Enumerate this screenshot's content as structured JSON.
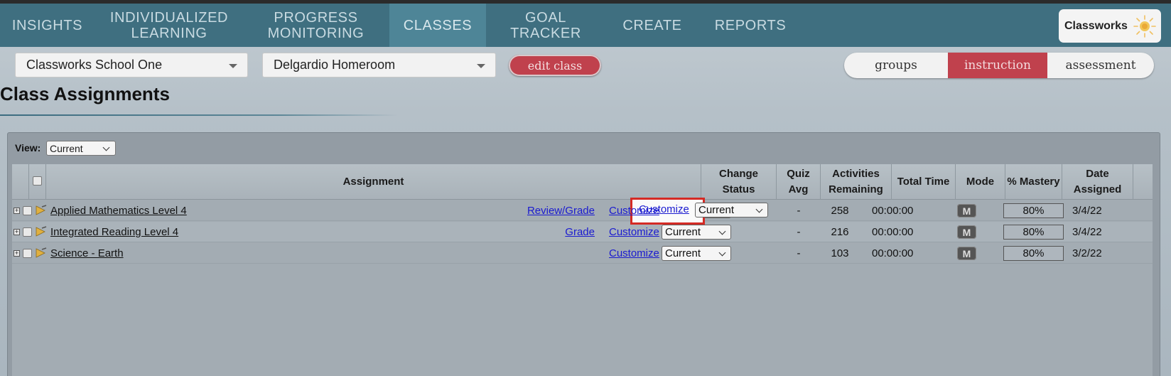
{
  "nav": {
    "items": [
      {
        "label": "INSIGHTS"
      },
      {
        "label": "INDIVIDUALIZED LEARNING"
      },
      {
        "label": "PROGRESS MONITORING"
      },
      {
        "label": "CLASSES"
      },
      {
        "label": "GOAL TRACKER"
      },
      {
        "label": "CREATE"
      },
      {
        "label": "REPORTS"
      }
    ],
    "active": "CLASSES",
    "brand": "Classworks"
  },
  "selectors": {
    "school": "Classworks School One",
    "class": "Delgardio Homeroom",
    "edit_class": "edit class"
  },
  "segments": {
    "groups": "groups",
    "instruction": "instruction",
    "assessment": "assessment",
    "selected": "instruction"
  },
  "page_title": "Class Assignments",
  "view": {
    "label": "View:",
    "value": "Current"
  },
  "table": {
    "headers": {
      "assignment": "Assignment",
      "change_status_1": "Change",
      "change_status_2": "Status",
      "quiz_avg_1": "Quiz",
      "quiz_avg_2": "Avg",
      "activities_1": "Activities",
      "activities_2": "Remaining",
      "total_time": "Total Time",
      "mode": "Mode",
      "mastery": "% Mastery",
      "date_1": "Date",
      "date_2": "Assigned"
    },
    "rows": [
      {
        "name": "Applied Mathematics Level 4",
        "grade_link": "Review/Grade",
        "customize": "Customize",
        "status": "Current",
        "quiz_avg": "-",
        "remaining": "258",
        "time": "00:00:00",
        "mode": "M",
        "mastery": "80%",
        "date": "3/4/22"
      },
      {
        "name": "Integrated Reading Level 4",
        "grade_link": "Grade",
        "customize": "Customize",
        "status": "Current",
        "quiz_avg": "-",
        "remaining": "216",
        "time": "00:00:00",
        "mode": "M",
        "mastery": "80%",
        "date": "3/4/22"
      },
      {
        "name": "Science - Earth",
        "grade_link": "",
        "customize": "Customize",
        "status": "Current",
        "quiz_avg": "-",
        "remaining": "103",
        "time": "00:00:00",
        "mode": "M",
        "mastery": "80%",
        "date": "3/2/22"
      }
    ]
  },
  "colors": {
    "nav_bg": "#3f6f80",
    "accent_red": "#c0414d",
    "highlight_box": "#d42a24",
    "link_blue": "#1a1ad0"
  }
}
